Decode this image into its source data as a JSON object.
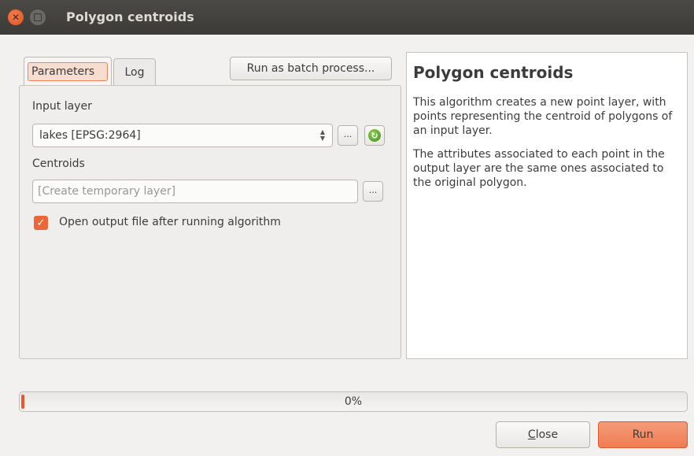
{
  "window": {
    "title": "Polygon centroids"
  },
  "tabs": {
    "parameters": "Parameters",
    "log": "Log"
  },
  "toolbar": {
    "batch_label": "Run as batch process..."
  },
  "params": {
    "input_layer_label": "Input layer",
    "input_layer_value": "lakes [EPSG:2964]",
    "browse_label": "...",
    "centroids_label": "Centroids",
    "centroids_placeholder": "[Create temporary layer]",
    "open_output_label": "Open output file after running algorithm",
    "open_output_checked": true
  },
  "help": {
    "title": "Polygon centroids",
    "paragraphs": [
      "This algorithm creates a new point layer, with points representing the centroid of polygons of an input layer.",
      "The attributes associated to each point in the output layer are the same ones associated to the original polygon."
    ]
  },
  "progress": {
    "value": 0,
    "text": "0%"
  },
  "buttons": {
    "close_label": "Close",
    "run_label": "Run"
  },
  "colors": {
    "accent": "#e9572a",
    "titlebar": "#3c3b37"
  }
}
